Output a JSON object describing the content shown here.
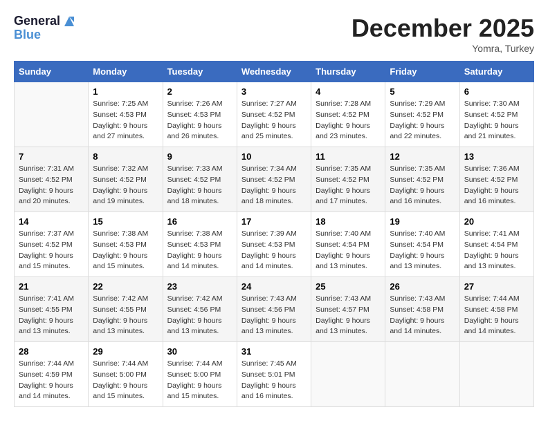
{
  "header": {
    "logo_line1": "General",
    "logo_line2": "Blue",
    "month": "December 2025",
    "location": "Yomra, Turkey"
  },
  "days_of_week": [
    "Sunday",
    "Monday",
    "Tuesday",
    "Wednesday",
    "Thursday",
    "Friday",
    "Saturday"
  ],
  "weeks": [
    [
      {
        "day": "",
        "sunrise": "",
        "sunset": "",
        "daylight": ""
      },
      {
        "day": "1",
        "sunrise": "7:25 AM",
        "sunset": "4:53 PM",
        "daylight": "9 hours and 27 minutes."
      },
      {
        "day": "2",
        "sunrise": "7:26 AM",
        "sunset": "4:53 PM",
        "daylight": "9 hours and 26 minutes."
      },
      {
        "day": "3",
        "sunrise": "7:27 AM",
        "sunset": "4:52 PM",
        "daylight": "9 hours and 25 minutes."
      },
      {
        "day": "4",
        "sunrise": "7:28 AM",
        "sunset": "4:52 PM",
        "daylight": "9 hours and 23 minutes."
      },
      {
        "day": "5",
        "sunrise": "7:29 AM",
        "sunset": "4:52 PM",
        "daylight": "9 hours and 22 minutes."
      },
      {
        "day": "6",
        "sunrise": "7:30 AM",
        "sunset": "4:52 PM",
        "daylight": "9 hours and 21 minutes."
      }
    ],
    [
      {
        "day": "7",
        "sunrise": "7:31 AM",
        "sunset": "4:52 PM",
        "daylight": "9 hours and 20 minutes."
      },
      {
        "day": "8",
        "sunrise": "7:32 AM",
        "sunset": "4:52 PM",
        "daylight": "9 hours and 19 minutes."
      },
      {
        "day": "9",
        "sunrise": "7:33 AM",
        "sunset": "4:52 PM",
        "daylight": "9 hours and 18 minutes."
      },
      {
        "day": "10",
        "sunrise": "7:34 AM",
        "sunset": "4:52 PM",
        "daylight": "9 hours and 18 minutes."
      },
      {
        "day": "11",
        "sunrise": "7:35 AM",
        "sunset": "4:52 PM",
        "daylight": "9 hours and 17 minutes."
      },
      {
        "day": "12",
        "sunrise": "7:35 AM",
        "sunset": "4:52 PM",
        "daylight": "9 hours and 16 minutes."
      },
      {
        "day": "13",
        "sunrise": "7:36 AM",
        "sunset": "4:52 PM",
        "daylight": "9 hours and 16 minutes."
      }
    ],
    [
      {
        "day": "14",
        "sunrise": "7:37 AM",
        "sunset": "4:52 PM",
        "daylight": "9 hours and 15 minutes."
      },
      {
        "day": "15",
        "sunrise": "7:38 AM",
        "sunset": "4:53 PM",
        "daylight": "9 hours and 15 minutes."
      },
      {
        "day": "16",
        "sunrise": "7:38 AM",
        "sunset": "4:53 PM",
        "daylight": "9 hours and 14 minutes."
      },
      {
        "day": "17",
        "sunrise": "7:39 AM",
        "sunset": "4:53 PM",
        "daylight": "9 hours and 14 minutes."
      },
      {
        "day": "18",
        "sunrise": "7:40 AM",
        "sunset": "4:54 PM",
        "daylight": "9 hours and 13 minutes."
      },
      {
        "day": "19",
        "sunrise": "7:40 AM",
        "sunset": "4:54 PM",
        "daylight": "9 hours and 13 minutes."
      },
      {
        "day": "20",
        "sunrise": "7:41 AM",
        "sunset": "4:54 PM",
        "daylight": "9 hours and 13 minutes."
      }
    ],
    [
      {
        "day": "21",
        "sunrise": "7:41 AM",
        "sunset": "4:55 PM",
        "daylight": "9 hours and 13 minutes."
      },
      {
        "day": "22",
        "sunrise": "7:42 AM",
        "sunset": "4:55 PM",
        "daylight": "9 hours and 13 minutes."
      },
      {
        "day": "23",
        "sunrise": "7:42 AM",
        "sunset": "4:56 PM",
        "daylight": "9 hours and 13 minutes."
      },
      {
        "day": "24",
        "sunrise": "7:43 AM",
        "sunset": "4:56 PM",
        "daylight": "9 hours and 13 minutes."
      },
      {
        "day": "25",
        "sunrise": "7:43 AM",
        "sunset": "4:57 PM",
        "daylight": "9 hours and 13 minutes."
      },
      {
        "day": "26",
        "sunrise": "7:43 AM",
        "sunset": "4:58 PM",
        "daylight": "9 hours and 14 minutes."
      },
      {
        "day": "27",
        "sunrise": "7:44 AM",
        "sunset": "4:58 PM",
        "daylight": "9 hours and 14 minutes."
      }
    ],
    [
      {
        "day": "28",
        "sunrise": "7:44 AM",
        "sunset": "4:59 PM",
        "daylight": "9 hours and 14 minutes."
      },
      {
        "day": "29",
        "sunrise": "7:44 AM",
        "sunset": "5:00 PM",
        "daylight": "9 hours and 15 minutes."
      },
      {
        "day": "30",
        "sunrise": "7:44 AM",
        "sunset": "5:00 PM",
        "daylight": "9 hours and 15 minutes."
      },
      {
        "day": "31",
        "sunrise": "7:45 AM",
        "sunset": "5:01 PM",
        "daylight": "9 hours and 16 minutes."
      },
      {
        "day": "",
        "sunrise": "",
        "sunset": "",
        "daylight": ""
      },
      {
        "day": "",
        "sunrise": "",
        "sunset": "",
        "daylight": ""
      },
      {
        "day": "",
        "sunrise": "",
        "sunset": "",
        "daylight": ""
      }
    ]
  ]
}
